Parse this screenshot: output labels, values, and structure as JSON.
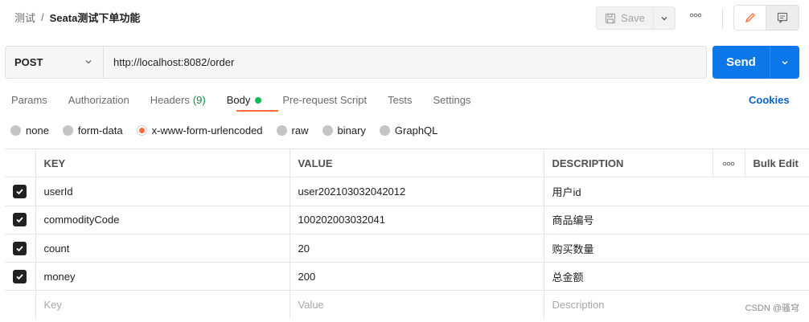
{
  "header": {
    "breadcrumb_parent": "测试",
    "breadcrumb_sep": "/",
    "breadcrumb_current": "Seata测试下单功能",
    "save_label": "Save",
    "more_icon": "more-horizontal-icon",
    "edit_icon": "pencil-icon",
    "comment_icon": "comment-icon"
  },
  "request": {
    "method": "POST",
    "url": "http://localhost:8082/order",
    "send_label": "Send"
  },
  "tabs": [
    {
      "label": "Params",
      "active": false
    },
    {
      "label": "Authorization",
      "active": false
    },
    {
      "label": "Headers",
      "count": "(9)",
      "active": false
    },
    {
      "label": "Body",
      "active": true
    },
    {
      "label": "Pre-request Script",
      "active": false
    },
    {
      "label": "Tests",
      "active": false
    },
    {
      "label": "Settings",
      "active": false
    }
  ],
  "cookies_label": "Cookies",
  "body_types": [
    {
      "label": "none",
      "selected": false
    },
    {
      "label": "form-data",
      "selected": false
    },
    {
      "label": "x-www-form-urlencoded",
      "selected": true
    },
    {
      "label": "raw",
      "selected": false
    },
    {
      "label": "binary",
      "selected": false
    },
    {
      "label": "GraphQL",
      "selected": false
    }
  ],
  "table": {
    "headers": {
      "key": "KEY",
      "value": "VALUE",
      "description": "DESCRIPTION",
      "more": "ooo",
      "bulk_edit": "Bulk Edit"
    },
    "rows": [
      {
        "checked": true,
        "key": "userId",
        "value": "user202103032042012",
        "description": "用户id"
      },
      {
        "checked": true,
        "key": "commodityCode",
        "value": "100202003032041",
        "description": "商品编号"
      },
      {
        "checked": true,
        "key": "count",
        "value": "20",
        "description": "购买数量"
      },
      {
        "checked": true,
        "key": "money",
        "value": "200",
        "description": "总金额"
      }
    ],
    "placeholder": {
      "key": "Key",
      "value": "Value",
      "description": "Description"
    }
  },
  "watermark": "CSDN @骚穹",
  "colors": {
    "accent": "#ff6c37",
    "send": "#0b77e8",
    "link": "#0b62c4",
    "status_green": "#0cbb52"
  }
}
